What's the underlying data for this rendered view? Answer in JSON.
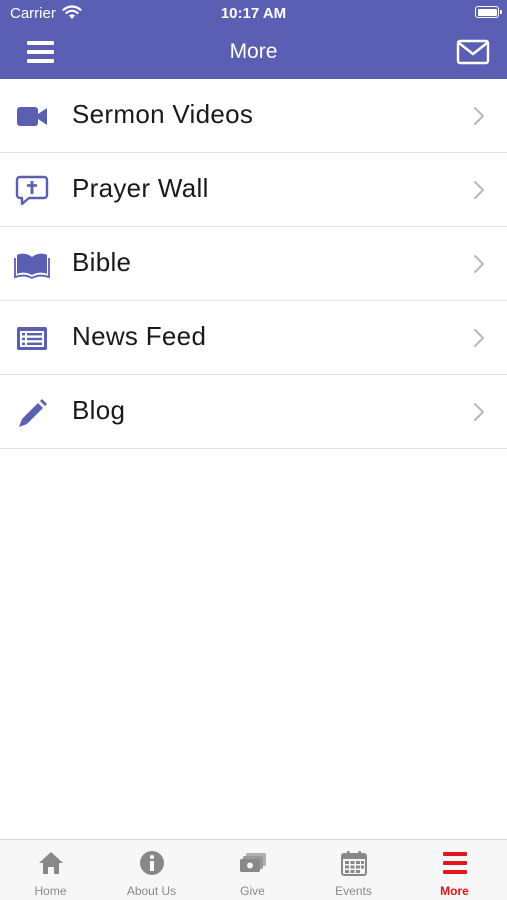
{
  "status_bar": {
    "carrier": "Carrier",
    "time": "10:17 AM"
  },
  "nav": {
    "title": "More"
  },
  "menu": [
    {
      "label": "Sermon Videos",
      "icon": "video-camera-icon"
    },
    {
      "label": "Prayer Wall",
      "icon": "prayer-bubble-icon"
    },
    {
      "label": "Bible",
      "icon": "open-book-icon"
    },
    {
      "label": "News Feed",
      "icon": "news-list-icon"
    },
    {
      "label": "Blog",
      "icon": "pencil-icon"
    }
  ],
  "tabs": [
    {
      "label": "Home",
      "icon": "home-icon",
      "active": false
    },
    {
      "label": "About Us",
      "icon": "info-icon",
      "active": false
    },
    {
      "label": "Give",
      "icon": "money-icon",
      "active": false
    },
    {
      "label": "Events",
      "icon": "calendar-icon",
      "active": false
    },
    {
      "label": "More",
      "icon": "hamburger-icon",
      "active": true
    }
  ],
  "colors": {
    "header": "#5A5FB4",
    "icon_accent": "#5A5FB4",
    "active_tab": "#E3151D",
    "inactive_tab": "#888888"
  }
}
